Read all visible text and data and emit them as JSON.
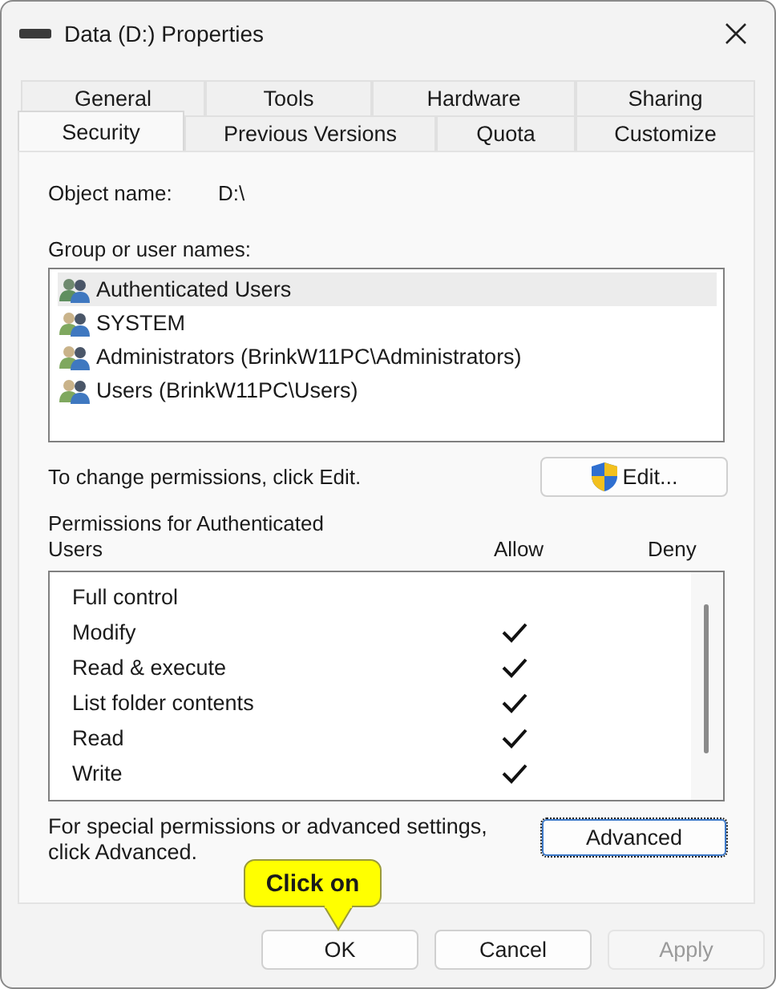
{
  "window": {
    "title": "Data (D:) Properties"
  },
  "tab_rows": [
    [
      {
        "label": "General",
        "selected": false
      },
      {
        "label": "Tools",
        "selected": false
      },
      {
        "label": "Hardware",
        "selected": false
      },
      {
        "label": "Sharing",
        "selected": false
      }
    ],
    [
      {
        "label": "Security",
        "selected": true
      },
      {
        "label": "Previous Versions",
        "selected": false
      },
      {
        "label": "Quota",
        "selected": false
      },
      {
        "label": "Customize",
        "selected": false
      }
    ]
  ],
  "object_name": {
    "label": "Object name:",
    "value": "D:\\"
  },
  "groups": {
    "label": "Group or user names:",
    "items": [
      {
        "name": "Authenticated Users",
        "selected": true
      },
      {
        "name": "SYSTEM",
        "selected": false
      },
      {
        "name": "Administrators (BrinkW11PC\\Administrators)",
        "selected": false
      },
      {
        "name": "Users (BrinkW11PC\\Users)",
        "selected": false
      }
    ]
  },
  "edit_hint": "To change permissions, click Edit.",
  "edit_button": "Edit...",
  "permissions": {
    "label": "Permissions for Authenticated Users",
    "allow_header": "Allow",
    "deny_header": "Deny",
    "rows": [
      {
        "name": "Full control",
        "allow": false,
        "deny": false
      },
      {
        "name": "Modify",
        "allow": true,
        "deny": false
      },
      {
        "name": "Read & execute",
        "allow": true,
        "deny": false
      },
      {
        "name": "List folder contents",
        "allow": true,
        "deny": false
      },
      {
        "name": "Read",
        "allow": true,
        "deny": false
      },
      {
        "name": "Write",
        "allow": true,
        "deny": false
      }
    ]
  },
  "advanced_hint": "For special permissions or advanced settings, click Advanced.",
  "advanced_button": "Advanced",
  "callout": "Click on",
  "buttons": [
    {
      "label": "OK",
      "disabled": false
    },
    {
      "label": "Cancel",
      "disabled": false
    },
    {
      "label": "Apply",
      "disabled": true
    }
  ]
}
